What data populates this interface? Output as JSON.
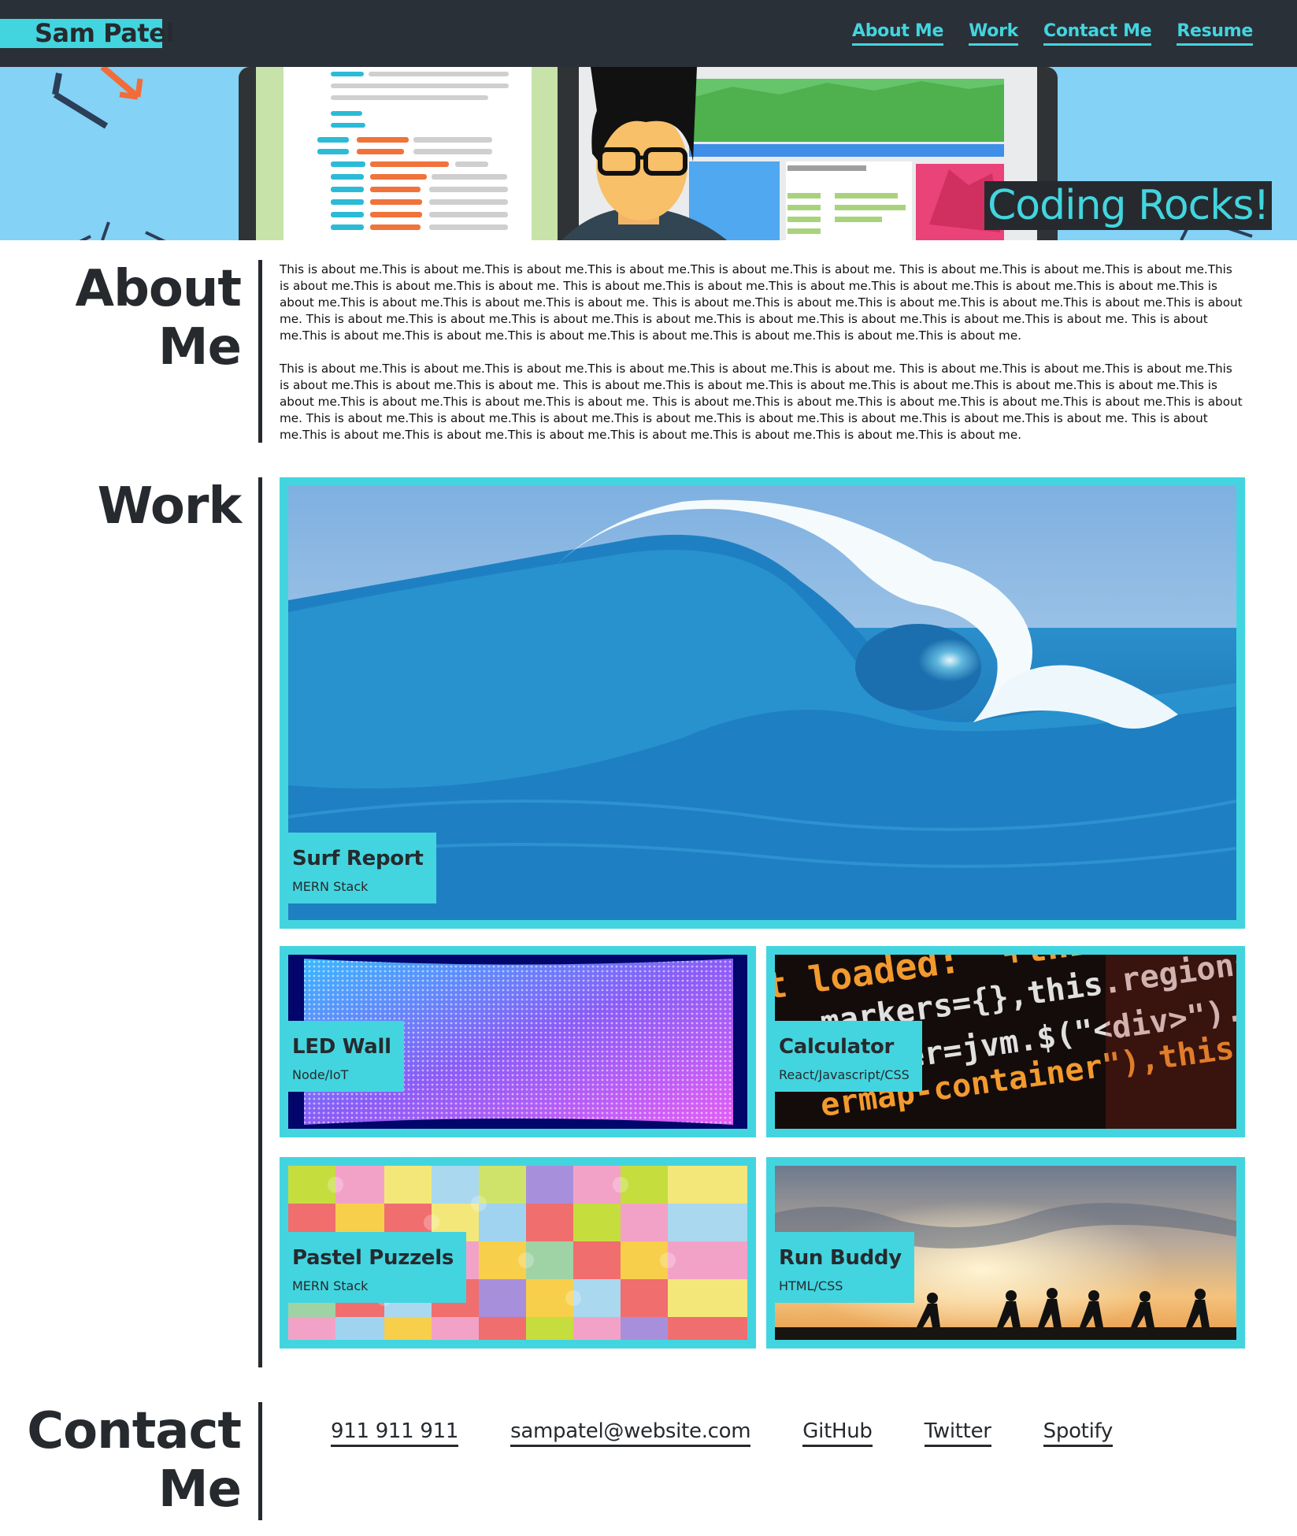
{
  "header": {
    "brand": "Sam Patel",
    "nav": [
      "About Me",
      "Work",
      "Contact Me",
      "Resume"
    ]
  },
  "hero": {
    "tagline": "Coding Rocks!"
  },
  "about": {
    "title_line1": "About",
    "title_line2": "Me",
    "paragraphs": [
      "This is about me.This is about me.This is about me.This is about me.This is about me.This is about me. This is about me.This is about me.This is about me.This is about me.This is about me.This is about me. This is about me.This is about me.This is about me.This is about me.This is about me.This is about me.This is about me.This is about me.This is about me.This is about me. This is about me.This is about me.This is about me.This is about me.This is about me.This is about me. This is about me.This is about me.This is about me.This is about me.This is about me.This is about me.This is about me.This is about me. This is about me.This is about me.This is about me.This is about me.This is about me.This is about me.This is about me.This is about me.",
      "This is about me.This is about me.This is about me.This is about me.This is about me.This is about me. This is about me.This is about me.This is about me.This is about me.This is about me.This is about me. This is about me.This is about me.This is about me.This is about me.This is about me.This is about me.This is about me.This is about me.This is about me.This is about me. This is about me.This is about me.This is about me.This is about me.This is about me.This is about me. This is about me.This is about me.This is about me.This is about me.This is about me.This is about me.This is about me.This is about me. This is about me.This is about me.This is about me.This is about me.This is about me.This is about me.This is about me.This is about me."
    ]
  },
  "work": {
    "title": "Work",
    "projects": [
      {
        "title": "Surf Report",
        "stack": "MERN Stack",
        "image": "ocean-wave-image"
      },
      {
        "title": "LED Wall",
        "stack": "Node/IoT",
        "image": "led-panel-image"
      },
      {
        "title": "Calculator",
        "stack": "React/Javascript/CSS",
        "image": "code-screen-image"
      },
      {
        "title": "Pastel Puzzels",
        "stack": "MERN Stack",
        "image": "puzzle-pieces-image"
      },
      {
        "title": "Run Buddy",
        "stack": "HTML/CSS",
        "image": "runners-sunset-image"
      }
    ]
  },
  "contact": {
    "title_line1": "Contact",
    "title_line2": "Me",
    "links": [
      "911 911 911",
      "sampatel@website.com",
      "GitHub",
      "Twitter",
      "Spotify"
    ]
  },
  "colors": {
    "accent": "#43d5df",
    "dark": "#262a2e",
    "nav_bg": "#2a3038",
    "hero_bg": "#84d2f5"
  }
}
